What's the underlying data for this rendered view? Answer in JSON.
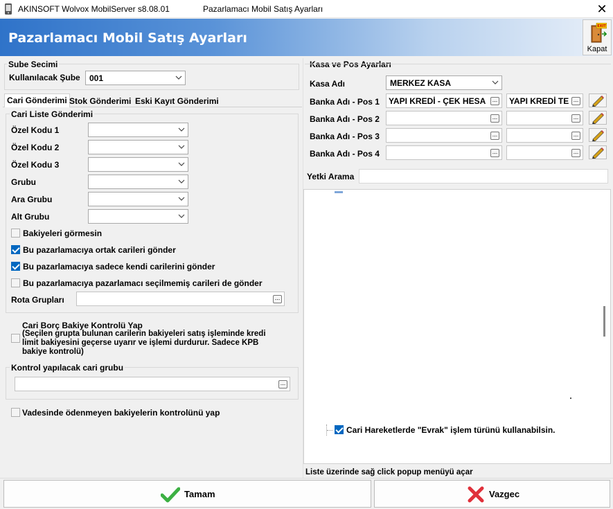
{
  "window": {
    "app_title": "AKINSOFT Wolvox MobilServer s8.08.01",
    "title": "Pazarlamacı Mobil Satış Ayarları",
    "close_glyph": "✕"
  },
  "header": {
    "title": "Pazarlamacı Mobil Satış Ayarları",
    "kapat_label": "Kapat",
    "kapat_badge": "EXIT"
  },
  "sube": {
    "group_title": "Sube Secimi",
    "label": "Kullanılacak Şube",
    "value": "001"
  },
  "tabs": [
    {
      "label": "Cari Gönderimi",
      "active": true
    },
    {
      "label": "Stok Gönderimi",
      "active": false
    },
    {
      "label": "Eski Kayıt Gönderimi",
      "active": false
    }
  ],
  "cari_liste": {
    "group_title": "Cari Liste Gönderimi",
    "fields": [
      {
        "label": "Özel Kodu 1",
        "value": ""
      },
      {
        "label": "Özel Kodu 2",
        "value": ""
      },
      {
        "label": "Özel Kodu 3",
        "value": ""
      },
      {
        "label": "Grubu",
        "value": ""
      },
      {
        "label": "Ara Grubu",
        "value": ""
      },
      {
        "label": "Alt Grubu",
        "value": ""
      }
    ],
    "checkboxes": [
      {
        "label": "Bakiyeleri görmesin",
        "checked": false
      },
      {
        "label": "Bu pazarlamacıya ortak carileri gönder",
        "checked": true
      },
      {
        "label": "Bu pazarlamacıya sadece kendi carilerini gönder",
        "checked": true
      },
      {
        "label": "Bu pazarlamacıya pazarlamacı seçilmemiş carileri de gönder",
        "checked": false
      }
    ],
    "rota_label": "Rota Grupları",
    "rota_value": ""
  },
  "borc": {
    "checked": false,
    "title": "Cari Borç Bakiye Kontrolü Yap",
    "line1": "(Seçilen grupta bulunan carilerin bakiyeleri satış işleminde kredi",
    "line2": "limit bakiyesini geçerse uyarır ve işlemi durdurur. Sadece KPB",
    "line3": "bakiye kontrolü)"
  },
  "kontrol": {
    "group_title": "Kontrol yapılacak cari grubu",
    "value": ""
  },
  "vade": {
    "label": "Vadesinde ödenmeyen bakiyelerin kontrolünü yap",
    "checked": false
  },
  "kasa": {
    "group_title": "Kasa ve Pos Ayarları",
    "kasa_label": "Kasa Adı",
    "kasa_value": "MERKEZ KASA",
    "pos_rows": [
      {
        "label": "Banka Adı - Pos 1",
        "bank": "YAPI KREDİ - ÇEK HESA",
        "account": "YAPI KREDİ TE"
      },
      {
        "label": "Banka Adı - Pos 2",
        "bank": "",
        "account": ""
      },
      {
        "label": "Banka Adı - Pos 3",
        "bank": "",
        "account": ""
      },
      {
        "label": "Banka Adı - Pos 4",
        "bank": "",
        "account": ""
      }
    ]
  },
  "yetki": {
    "label": "Yetki Arama",
    "value": ""
  },
  "tree": {
    "item_label": "Cari Hareketlerde \"Evrak\" işlem türünü kullanabilsin.",
    "item_checked": true
  },
  "status_text": "Liste üzerinde sağ click popup menüyü açar",
  "footer": {
    "ok_label": "Tamam",
    "cancel_label": "Vazgec"
  },
  "colors": {
    "header_gradient_start": "#2f73c9",
    "checkbox_accent": "#0067c0",
    "ok_icon": "#3cb043",
    "cancel_icon": "#e0303a"
  }
}
